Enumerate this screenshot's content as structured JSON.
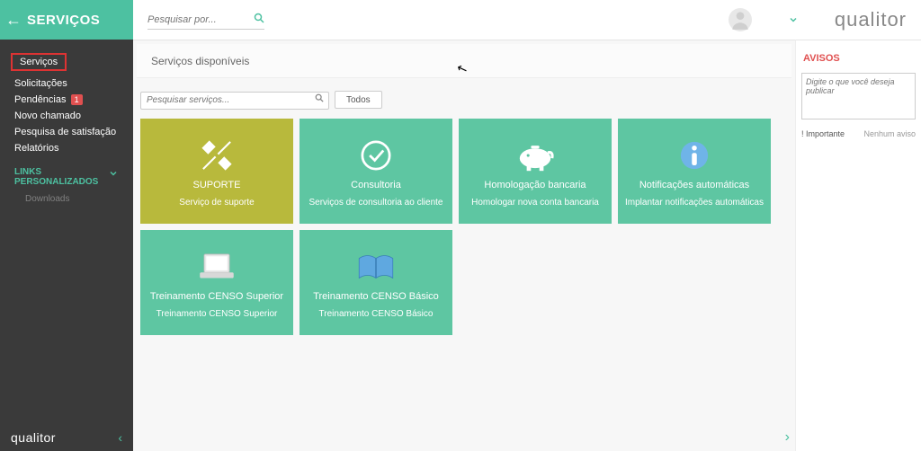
{
  "header": {
    "app_title": "SERVIÇOS",
    "search_placeholder": "Pesquisar por...",
    "brand": "qualitor"
  },
  "sidebar": {
    "items": [
      {
        "label": "Serviços",
        "selected": true
      },
      {
        "label": "Solicitações"
      },
      {
        "label": "Pendências",
        "badge": "1"
      },
      {
        "label": "Novo chamado"
      },
      {
        "label": "Pesquisa de satisfação"
      },
      {
        "label": "Relatórios"
      }
    ],
    "links_title": "LINKS PERSONALIZADOS",
    "downloads_label": "Downloads",
    "footer_brand": "qualitor"
  },
  "main": {
    "panel_title": "Serviços disponíveis",
    "filter_placeholder": "Pesquisar serviços...",
    "filter_button": "Todos",
    "cards": [
      {
        "title": "SUPORTE",
        "subtitle": "Serviço de suporte",
        "color": "yellow",
        "icon": "tools"
      },
      {
        "title": "Consultoria",
        "subtitle": "Serviços de consultoria ao cliente",
        "color": "green",
        "icon": "check"
      },
      {
        "title": "Homologação bancaria",
        "subtitle": "Homologar nova conta bancaria",
        "color": "green",
        "icon": "piggy"
      },
      {
        "title": "Notificações automáticas",
        "subtitle": "Implantar notificações automáticas",
        "color": "green",
        "icon": "info"
      },
      {
        "title": "Treinamento CENSO Superior",
        "subtitle": "Treinamento CENSO Superior",
        "color": "green",
        "icon": "laptop"
      },
      {
        "title": "Treinamento CENSO Básico",
        "subtitle": "Treinamento CENSO Básico",
        "color": "green",
        "icon": "book"
      }
    ]
  },
  "right": {
    "title": "AVISOS",
    "post_placeholder": "Digite o que você deseja publicar",
    "important_label": "! Importante",
    "no_notice_label": "Nenhum aviso"
  }
}
